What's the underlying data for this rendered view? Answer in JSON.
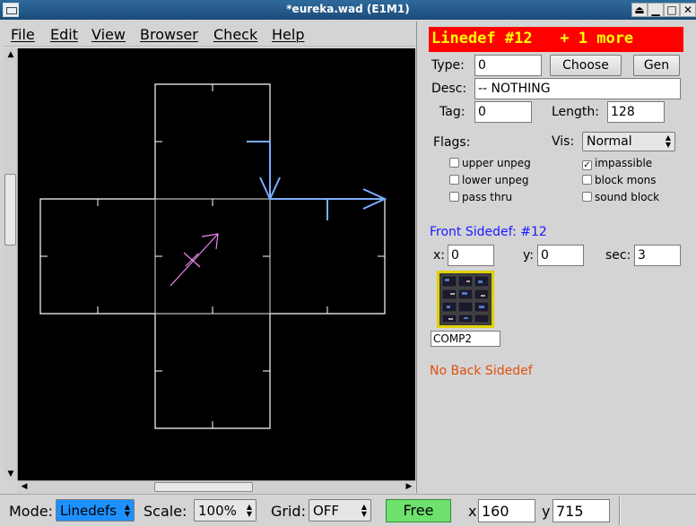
{
  "window": {
    "title": "*eureka.wad (E1M1)"
  },
  "menu": [
    "File",
    "Edit",
    "View",
    "Browser",
    "Check",
    "Help"
  ],
  "panel": {
    "header": "Linedef #12   + 1 more",
    "type_label": "Type:",
    "type_value": "0",
    "choose_label": "Choose",
    "gen_label": "Gen",
    "desc_label": "Desc:",
    "desc_value": "-- NOTHING",
    "tag_label": "Tag:",
    "tag_value": "0",
    "length_label": "Length:",
    "length_value": "128",
    "flags_label": "Flags:",
    "vis_label": "Vis:",
    "vis_value": "Normal",
    "flags": [
      {
        "label": "upper unpeg",
        "checked": false
      },
      {
        "label": "impassible",
        "checked": true
      },
      {
        "label": "lower unpeg",
        "checked": false
      },
      {
        "label": "block mons",
        "checked": false
      },
      {
        "label": "pass thru",
        "checked": false
      },
      {
        "label": "sound block",
        "checked": false
      }
    ],
    "front_label": "Front Sidedef: #12",
    "x_label": "x:",
    "x_value": "0",
    "y_label": "y:",
    "y_value": "0",
    "sec_label": "sec:",
    "sec_value": "3",
    "texture_name": "COMP2",
    "back_label": "No Back Sidedef"
  },
  "status": {
    "mode_label": "Mode:",
    "mode_value": "Linedefs",
    "scale_label": "Scale:",
    "scale_value": "100%",
    "grid_label": "Grid:",
    "grid_value": "OFF",
    "free_label": "Free",
    "x_label": "x",
    "x_value": "160",
    "y_label": "y",
    "y_value": "715"
  },
  "colors": {
    "header_bg": "#ff0000",
    "header_fg": "#ffff00",
    "front_label": "#1a1aff",
    "back_label": "#e05010",
    "mode_bg": "#1e90ff",
    "free_bg": "#6de06d",
    "selected_line": "#7aaeff"
  }
}
